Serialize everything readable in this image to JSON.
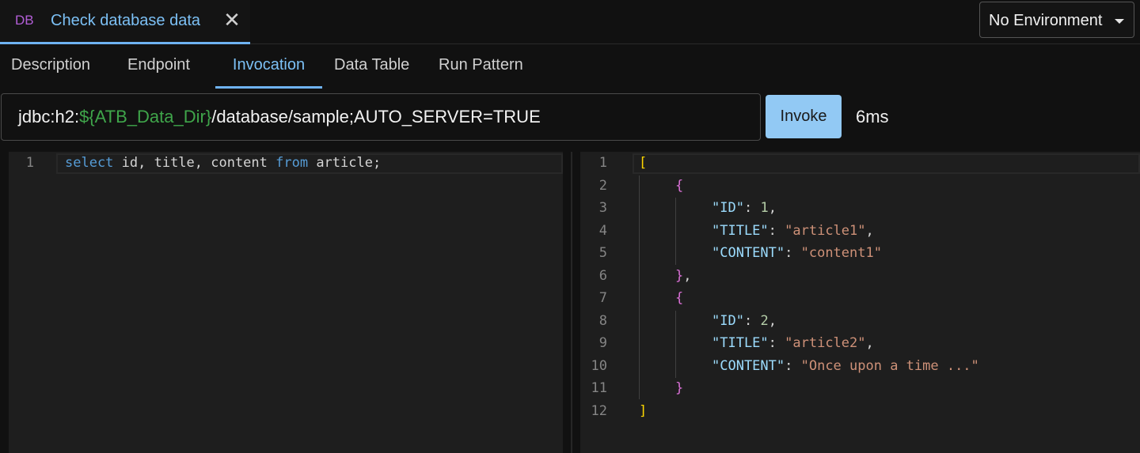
{
  "top_tab": {
    "type_badge": "DB",
    "title": "Check database data",
    "close_glyph": "✕"
  },
  "environment": {
    "selected": "No Environment"
  },
  "sub_tabs": [
    {
      "label": "Description"
    },
    {
      "label": "Endpoint"
    },
    {
      "label": "Invocation",
      "active": true
    },
    {
      "label": "Data Table"
    },
    {
      "label": "Run Pattern"
    }
  ],
  "request": {
    "url_prefix": "jdbc:h2:",
    "url_variable": "${ATB_Data_Dir}",
    "url_suffix": "/database/sample;AUTO_SERVER=TRUE",
    "invoke_label": "Invoke",
    "duration": "6ms"
  },
  "sql_editor": {
    "line_numbers": [
      "1"
    ],
    "tokens": {
      "kw_select": "select",
      "cols": " id, title, content ",
      "kw_from": "from",
      "rest": " article;"
    }
  },
  "result_editor": {
    "line_numbers": [
      "1",
      "2",
      "3",
      "4",
      "5",
      "6",
      "7",
      "8",
      "9",
      "10",
      "11",
      "12"
    ],
    "lines": [
      {
        "open": "["
      },
      {
        "open": "{"
      },
      {
        "key": "\"ID\"",
        "value": "1",
        "vtype": "num",
        "comma": ","
      },
      {
        "key": "\"TITLE\"",
        "value": "\"article1\"",
        "vtype": "str",
        "comma": ","
      },
      {
        "key": "\"CONTENT\"",
        "value": "\"content1\"",
        "vtype": "str",
        "comma": ""
      },
      {
        "close": "}",
        "comma": ","
      },
      {
        "open": "{"
      },
      {
        "key": "\"ID\"",
        "value": "2",
        "vtype": "num",
        "comma": ","
      },
      {
        "key": "\"TITLE\"",
        "value": "\"article2\"",
        "vtype": "str",
        "comma": ","
      },
      {
        "key": "\"CONTENT\"",
        "value": "\"Once upon a time ...\"",
        "vtype": "str",
        "comma": ""
      },
      {
        "close": "}"
      },
      {
        "close": "]"
      }
    ]
  },
  "colors": {
    "accent": "#6fb3f2",
    "invoke_button": "#92c9f4",
    "variable": "#3fa54a",
    "badge": "#b25ed6"
  }
}
